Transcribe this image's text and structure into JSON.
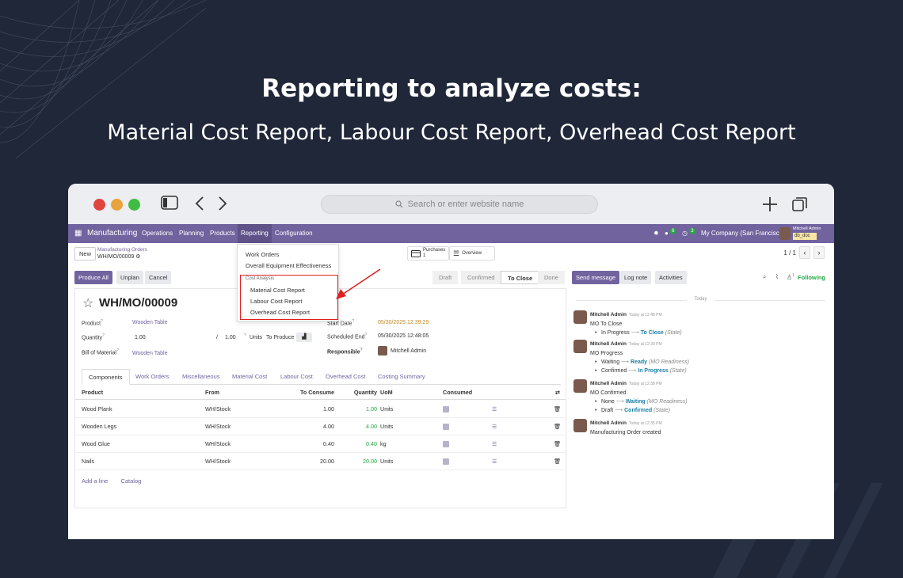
{
  "banner": {
    "title": "Reporting to analyze costs:",
    "subtitle": "Material Cost Report, Labour Cost Report, Overhead Cost Report"
  },
  "browser": {
    "url_placeholder": "Search or enter website name"
  },
  "navbar": {
    "app": "Manufacturing",
    "menus": [
      "Operations",
      "Planning",
      "Products",
      "Reporting",
      "Configuration"
    ],
    "chat_badge": "6",
    "activity_badge": "3",
    "company": "My Company (San Francisco)",
    "user_name": "Mitchell Admin",
    "db_name": "db_doc"
  },
  "control": {
    "new_label": "New",
    "breadcrumb_parent": "Manufacturing Orders",
    "breadcrumb_current": "WH/MO/00009",
    "purchases_label": "Purchases",
    "purchases_count": "1",
    "overview_label": "Overview",
    "pager": "1 / 1"
  },
  "reporting_menu": {
    "items": [
      "Work Orders",
      "Overall Equipment Effectiveness"
    ],
    "section": "Cost Analysis",
    "cost_items": [
      "Material Cost Report",
      "Labour Cost Report",
      "Overhead Cost Report"
    ]
  },
  "statusbar": {
    "buttons": [
      "Produce All",
      "Unplan",
      "Cancel"
    ],
    "stages": [
      "Draft",
      "Confirmed",
      "To Close",
      "Done"
    ],
    "current_stage": "To Close"
  },
  "form": {
    "title": "WH/MO/00009",
    "product_label": "Product",
    "product": "Wooden Table",
    "quantity_label": "Quantity",
    "quantity": "1.00",
    "quantity_sep": "/",
    "quantity_total": "1.00",
    "units_label": "Units",
    "to_produce": "To Produce",
    "bom_label": "Bill of Material",
    "bom": "Wooden Table",
    "start_label": "Start Date",
    "start_date": "05/30/2025 12:39:29",
    "end_label": "Scheduled End",
    "end_date": "05/30/2025 12:48:05",
    "responsible_label": "Responsible",
    "responsible": "Mitchell Admin"
  },
  "tabs": [
    "Components",
    "Work Orders",
    "Miscellaneous",
    "Material Cost",
    "Labour Cost",
    "Overhead Cost",
    "Costing Summary"
  ],
  "components": {
    "headers": [
      "Product",
      "From",
      "To Consume",
      "Quantity",
      "UoM",
      "Consumed"
    ],
    "rows": [
      {
        "product": "Wood Plank",
        "from": "WH/Stock",
        "to_consume": "1.00",
        "quantity": "1.00",
        "uom": "Units"
      },
      {
        "product": "Wooden Legs",
        "from": "WH/Stock",
        "to_consume": "4.00",
        "quantity": "4.00",
        "uom": "Units"
      },
      {
        "product": "Wood Glue",
        "from": "WH/Stock",
        "to_consume": "0.40",
        "quantity": "0.40",
        "uom": "kg"
      },
      {
        "product": "Nails",
        "from": "WH/Stock",
        "to_consume": "20.00",
        "quantity": "20.00",
        "uom": "Units"
      }
    ],
    "add_line": "Add a line",
    "catalog": "Catalog"
  },
  "chatter": {
    "send_message": "Send message",
    "log_note": "Log note",
    "activities": "Activities",
    "follower_count": "1",
    "following": "Following",
    "today": "Today",
    "messages": [
      {
        "author": "Mitchell Admin",
        "time": "Today at 12:48 PM",
        "text": "MO To Close",
        "track": [
          {
            "old": "In Progress",
            "new": "To Close",
            "field": "(State)"
          }
        ]
      },
      {
        "author": "Mitchell Admin",
        "time": "Today at 12:39 PM",
        "text": "MO Progress",
        "track": [
          {
            "old": "Waiting",
            "new": "Ready",
            "field": "(MO Readiness)"
          },
          {
            "old": "Confirmed",
            "new": "In Progress",
            "field": "(State)"
          }
        ]
      },
      {
        "author": "Mitchell Admin",
        "time": "Today at 12:38 PM",
        "text": "MO Confirmed",
        "track": [
          {
            "old": "None",
            "new": "Waiting",
            "field": "(MO Readiness)"
          },
          {
            "old": "Draft",
            "new": "Confirmed",
            "field": "(State)"
          }
        ]
      },
      {
        "author": "Mitchell Admin",
        "time": "Today at 12:35 PM",
        "text": "Manufacturing Order created",
        "track": []
      }
    ]
  },
  "colors": {
    "background": "#1f2739",
    "brand": "#71639e",
    "highlight_red": "#e02020",
    "success": "#28a745"
  }
}
